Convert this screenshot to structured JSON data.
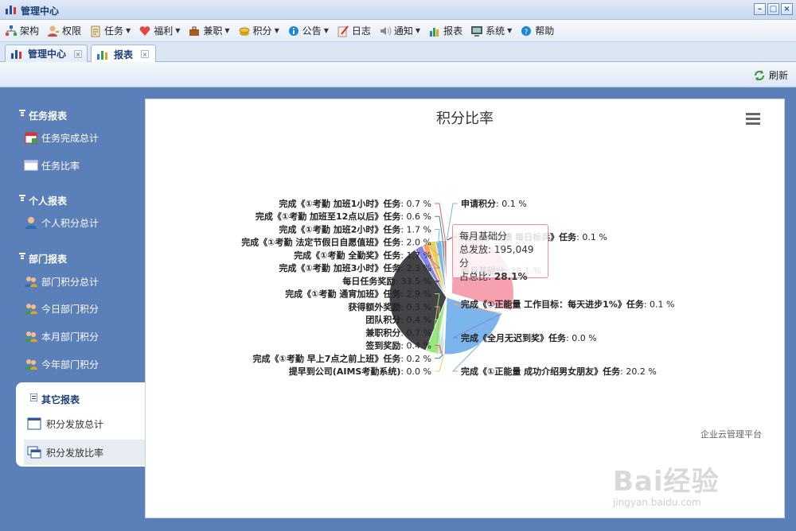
{
  "window": {
    "title": "管理中心",
    "controls": [
      "minimize",
      "maximize",
      "close"
    ]
  },
  "menu": [
    {
      "label": "架构",
      "icon": "org-chart-icon",
      "dropdown": false
    },
    {
      "label": "权限",
      "icon": "user-key-icon",
      "dropdown": false
    },
    {
      "label": "任务",
      "icon": "clipboard-icon",
      "dropdown": true
    },
    {
      "label": "福利",
      "icon": "heart-icon",
      "dropdown": true
    },
    {
      "label": "兼职",
      "icon": "briefcase-icon",
      "dropdown": true
    },
    {
      "label": "积分",
      "icon": "coins-icon",
      "dropdown": true
    },
    {
      "label": "公告",
      "icon": "info-icon",
      "dropdown": true
    },
    {
      "label": "日志",
      "icon": "pen-icon",
      "dropdown": false
    },
    {
      "label": "通知",
      "icon": "speaker-icon",
      "dropdown": true
    },
    {
      "label": "报表",
      "icon": "bar-chart-icon",
      "dropdown": false
    },
    {
      "label": "系统",
      "icon": "computer-icon",
      "dropdown": true
    },
    {
      "label": "帮助",
      "icon": "help-icon",
      "dropdown": false
    }
  ],
  "tabs": [
    {
      "label": "管理中心",
      "active": false
    },
    {
      "label": "报表",
      "active": true
    }
  ],
  "toolbar": {
    "refresh_label": "刷新"
  },
  "sidebar": {
    "sections": [
      {
        "title": "任务报表",
        "items": [
          "任务完成总计",
          "任务比率"
        ]
      },
      {
        "title": "个人报表",
        "items": [
          "个人积分总计"
        ]
      },
      {
        "title": "部门报表",
        "items": [
          "部门积分总计",
          "今日部门积分",
          "本月部门积分",
          "今年部门积分"
        ]
      }
    ],
    "other": {
      "title": "其它报表",
      "items": [
        "积分发放总计",
        "积分发放比率"
      ],
      "active_item": "积分发放比率"
    }
  },
  "credit": "企业云管理平台",
  "tooltip": {
    "name": "每月基础分",
    "total_label": "总发放",
    "total_value": "195,049分",
    "ratio_label": "占总比",
    "ratio_value": "28.1%"
  },
  "watermark": {
    "logo": "Bai经验",
    "url": "jingyan.baidu.com"
  },
  "chart_data": {
    "type": "pie",
    "title": "积分比率",
    "unit": "%",
    "slices": [
      {
        "label": "申请积分",
        "value": 0.1,
        "color": "#7cb5ec"
      },
      {
        "label": "完成《①业绩 每日标兵》任务",
        "value": 0.1,
        "color": "#434348"
      },
      {
        "label": "每月基础分",
        "value": 28.1,
        "color": "#f7a0b0"
      },
      {
        "label": "完成《①正能量 工作目标：每天进步1%》任务",
        "value": 0.1,
        "color": "#f7a35c"
      },
      {
        "label": "完成《全月无迟到奖》任务",
        "value": 0.0,
        "color": "#8085e9"
      },
      {
        "label": "完成《①正能量 成功介绍男女朋友》任务",
        "value": 20.2,
        "color": "#7cb5ec"
      },
      {
        "label": "提早到公司(AIMS考勤系统)",
        "value": 0.0,
        "color": "#e4d354"
      },
      {
        "label": "完成《①考勤 早上7点之前上班》任务",
        "value": 0.2,
        "color": "#2b908f"
      },
      {
        "label": "签到奖励",
        "value": 0.4,
        "color": "#f45b5b"
      },
      {
        "label": "兼职积分",
        "value": 0.7,
        "color": "#91e8e1"
      },
      {
        "label": "团队积分",
        "value": 0.4,
        "color": "#90ed7d"
      },
      {
        "label": "获得额外奖励",
        "value": 0.3,
        "color": "#f7a35c"
      },
      {
        "label": "完成《①考勤 通宵加班》任务",
        "value": 2.9,
        "color": "#90ed7d"
      },
      {
        "label": "每日任务奖励",
        "value": 33.5,
        "color": "#434348"
      },
      {
        "label": "完成《①考勤 加班3小时》任务",
        "value": 2.3,
        "color": "#8085e9"
      },
      {
        "label": "完成《①考勤 全勤奖》任务",
        "value": 1.7,
        "color": "#f7a35c"
      },
      {
        "label": "完成《①考勤 法定节假日自愿值班》任务",
        "value": 2.0,
        "color": "#e4d354"
      },
      {
        "label": "完成《①考勤 加班2小时》任务",
        "value": 1.7,
        "color": "#7cb5ec"
      },
      {
        "label": "完成《①考勤 加班至12点以后》任务",
        "value": 0.6,
        "color": "#2b908f"
      },
      {
        "label": "完成《①考勤 加班1小时》任务",
        "value": 0.7,
        "color": "#f45b5b"
      }
    ],
    "highlighted": "每月基础分",
    "legend": "none (data labels)"
  }
}
